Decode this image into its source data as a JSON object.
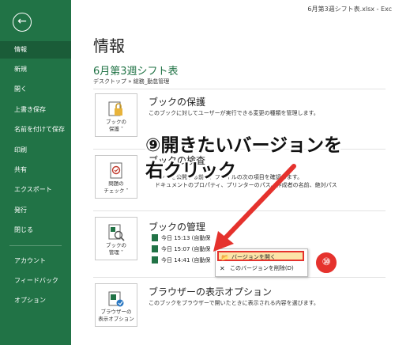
{
  "titlebar": {
    "text": "6月第3週シフト表.xlsx - Exc"
  },
  "sidebar": {
    "items": [
      {
        "label": "情報"
      },
      {
        "label": "新規"
      },
      {
        "label": "開く"
      },
      {
        "label": "上書き保存"
      },
      {
        "label": "名前を付けて保存"
      },
      {
        "label": "印刷"
      },
      {
        "label": "共有"
      },
      {
        "label": "エクスポート"
      },
      {
        "label": "発行"
      },
      {
        "label": "閉じる"
      },
      {
        "label": "アカウント"
      },
      {
        "label": "フィードバック"
      },
      {
        "label": "オプション"
      }
    ]
  },
  "main": {
    "title": "情報",
    "file_name": "6月第3週シフト表",
    "file_path": "デスクトップ » 総務_勤怠管理",
    "protect": {
      "tile_label": "ブックの\n保護",
      "tile_suffix": "˅",
      "heading": "ブックの保護",
      "desc": "このブックに対してユーザーが実行できる変更の種類を管理します。"
    },
    "inspect": {
      "tile_label": "問題の\nチェック",
      "tile_suffix": "˅",
      "heading": "ブックの検査",
      "desc1": "のブックを公開する前に、ファイルの次の項目を確認します。",
      "desc2": "ドキュメントのプロパティ、プリンターのパス、作成者の名前、絶対パス"
    },
    "manage": {
      "tile_label": "ブックの\n管理",
      "tile_suffix": "˅",
      "heading": "ブックの管理",
      "versions": [
        {
          "label": "今日 15:13 (自動保"
        },
        {
          "label": "今日 15:07 (自動保"
        },
        {
          "label": "今日 14:41 (自動保"
        }
      ]
    },
    "browser": {
      "tile_label": "ブラウザーの\n表示オプション",
      "heading": "ブラウザーの表示オプション",
      "desc": "このブックをブラウザーで開いたときに表示される内容を選びます。"
    }
  },
  "context_menu": {
    "open_label": "バージョンを開く",
    "delete_label": "このバージョンを削除(D)"
  },
  "annotations": {
    "step9_line1": "⑨開きたいバージョンを",
    "step9_line2": "右クリック",
    "step10": "⑩"
  },
  "colors": {
    "excel_green": "#217346",
    "annotation_red": "#e5322d"
  }
}
